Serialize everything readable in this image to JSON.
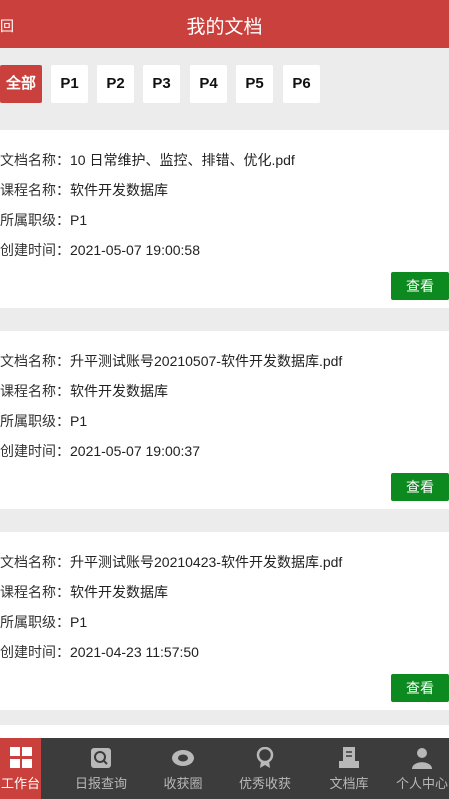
{
  "header": {
    "back_label": "回",
    "title": "我的文档"
  },
  "filters": [
    {
      "label": "全部",
      "active": true
    },
    {
      "label": "P1",
      "active": false
    },
    {
      "label": "P2",
      "active": false
    },
    {
      "label": "P3",
      "active": false
    },
    {
      "label": "P4",
      "active": false
    },
    {
      "label": "P5",
      "active": false
    },
    {
      "label": "P6",
      "active": false
    }
  ],
  "field_labels": {
    "doc_name": "文档名称：",
    "course_name": "课程名称：",
    "level": "所属职级：",
    "created": "创建时间："
  },
  "documents": [
    {
      "doc_name": "10 日常维护、监控、排错、优化.pdf",
      "course_name": "软件开发数据库",
      "level": "P1",
      "created": "2021-05-07 19:00:58",
      "view_label": "查看"
    },
    {
      "doc_name": "升平测试账号20210507-软件开发数据库.pdf",
      "course_name": "软件开发数据库",
      "level": "P1",
      "created": "2021-05-07 19:00:37",
      "view_label": "查看"
    },
    {
      "doc_name": "升平测试账号20210423-软件开发数据库.pdf",
      "course_name": "软件开发数据库",
      "level": "P1",
      "created": "2021-04-23 11:57:50",
      "view_label": "查看"
    }
  ],
  "tabbar": [
    {
      "label": "工作台",
      "icon": "grid-icon",
      "active": true
    },
    {
      "label": "日报查询",
      "icon": "report-search-icon",
      "active": false
    },
    {
      "label": "收获圈",
      "icon": "circle-icon",
      "active": false
    },
    {
      "label": "优秀收获",
      "icon": "award-icon",
      "active": false
    },
    {
      "label": "文档库",
      "icon": "library-icon",
      "active": false
    },
    {
      "label": "个人中心",
      "icon": "person-icon",
      "active": false
    }
  ],
  "colors": {
    "brand": "#c9403c",
    "button": "#0c8a1f",
    "tabbar_bg": "#3c3c3c"
  }
}
